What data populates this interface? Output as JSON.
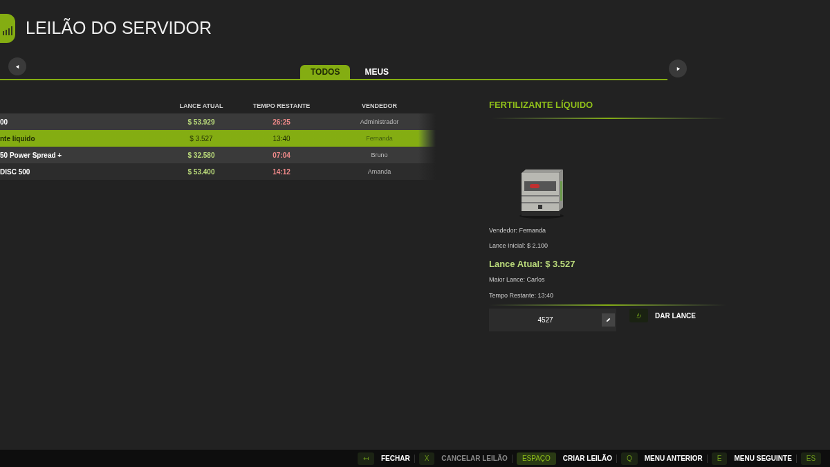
{
  "title": "LEILÃO DO SERVIDOR",
  "tabs": [
    {
      "label": "TODOS",
      "selected": true
    },
    {
      "label": "MEUS",
      "selected": false
    }
  ],
  "table": {
    "columns": [
      "LANCE ATUAL",
      "TEMPO RESTANTE",
      "VENDEDOR"
    ],
    "rows": [
      {
        "name": "00",
        "bid": "$ 53.929",
        "time": "26:25",
        "seller": "Administrador",
        "selected": false
      },
      {
        "name": "nte líquido",
        "bid": "$ 3.527",
        "time": "13:40",
        "seller": "Fernanda",
        "selected": true
      },
      {
        "name": "50 Power Spread +",
        "bid": "$ 32.580",
        "time": "07:04",
        "seller": "Bruno",
        "selected": false
      },
      {
        "name": "DISC 500",
        "bid": "$ 53.400",
        "time": "14:12",
        "seller": "Amanda",
        "selected": false
      }
    ]
  },
  "detail": {
    "title": "FERTILIZANTE LÍQUIDO",
    "seller": "Vendedor: Fernanda",
    "start_bid": "Lance Inicial: $ 2.100",
    "current_bid": "Lance Atual: $ 3.527",
    "top_bidder": "Maior Lance: Carlos",
    "time_left": "Tempo Restante: 13:40",
    "bid_input": {
      "value": "4527"
    },
    "bid_button": "DAR LANCE"
  },
  "footer": [
    {
      "key": "↤",
      "label": "FECHAR",
      "disabled": false,
      "highlighted": false
    },
    {
      "key": "X",
      "label": "CANCELAR LEILÃO",
      "disabled": true,
      "highlighted": false
    },
    {
      "key": "ESPAÇO",
      "label": "CRIAR LEILÃO",
      "disabled": false,
      "highlighted": true
    },
    {
      "key": "Q",
      "label": "MENU ANTERIOR",
      "disabled": false,
      "highlighted": false
    },
    {
      "key": "E",
      "label": "MENU SEGUINTE",
      "disabled": false,
      "highlighted": false
    },
    {
      "key": "ES",
      "highlighted": false
    }
  ]
}
